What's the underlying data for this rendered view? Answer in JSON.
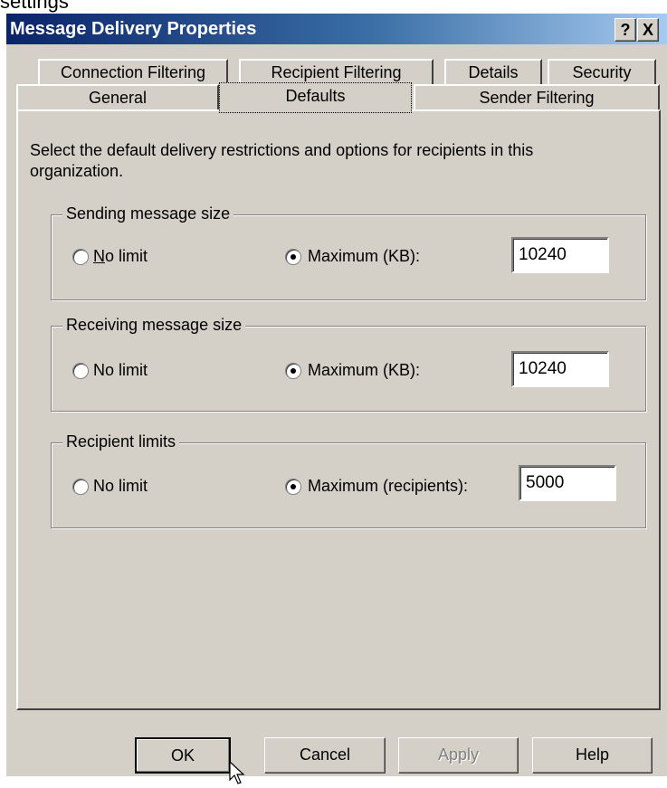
{
  "header_fragment": "settings",
  "window": {
    "title": "Message Delivery Properties",
    "help_button": "?",
    "close_button": "X"
  },
  "tabs": {
    "row_back": [
      "Connection Filtering",
      "Recipient Filtering",
      "Details",
      "Security"
    ],
    "row_front": [
      "General",
      "Defaults",
      "Sender Filtering"
    ],
    "active": "Defaults"
  },
  "intro_text": "Select the default delivery restrictions and options for recipients in this organization.",
  "sending": {
    "legend": "Sending message size",
    "no_limit_label": "No limit",
    "maximum_label": "Maximum (KB):",
    "selected": "maximum",
    "value": "10240"
  },
  "receiving": {
    "legend": "Receiving message size",
    "no_limit_label": "No limit",
    "maximum_label": "Maximum (KB):",
    "selected": "maximum",
    "value": "10240"
  },
  "recipient_limits": {
    "legend": "Recipient limits",
    "no_limit_label": "No limit",
    "maximum_label": "Maximum (recipients):",
    "selected": "maximum",
    "value": "5000"
  },
  "buttons": {
    "ok": "OK",
    "cancel": "Cancel",
    "apply": "Apply",
    "help": "Help"
  },
  "colors": {
    "dialog_face": "#d4d0c8",
    "titlebar_start": "#0a246a",
    "titlebar_end": "#a6caf0"
  }
}
